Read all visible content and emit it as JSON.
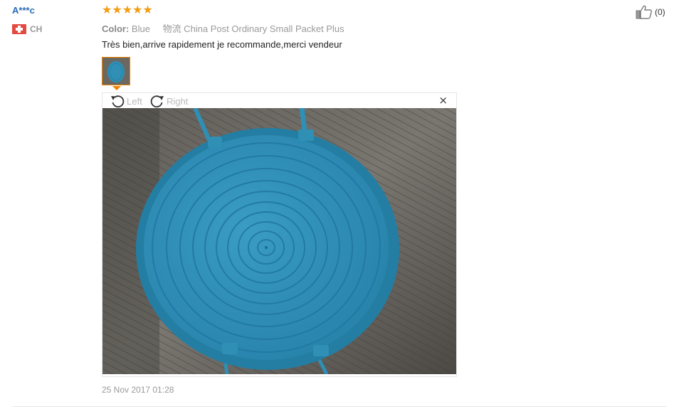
{
  "review": {
    "user_name": "A***c",
    "country_code": "CH",
    "rating_stars": 5,
    "color_label": "Color:",
    "color_value": "Blue",
    "shipping": "物流 China Post Ordinary Small Packet Plus",
    "text": "Très bien,arrive rapidement je recommande,merci vendeur",
    "date": "25 Nov 2017 01:28",
    "likes": "(0)"
  },
  "viewer": {
    "rotate_left_label": "Left",
    "rotate_right_label": "Right",
    "close_glyph": "×"
  },
  "icons": {
    "star": "star-icon",
    "flag": "switzerland-flag-icon",
    "like": "thumbs-up-icon",
    "rotate_left": "rotate-left-icon",
    "rotate_right": "rotate-right-icon",
    "close": "close-icon"
  },
  "colors": {
    "star": "#f39c12",
    "user_name": "#2a6bb3",
    "thumb_border": "#f08300",
    "product": "#2f8fb5"
  }
}
